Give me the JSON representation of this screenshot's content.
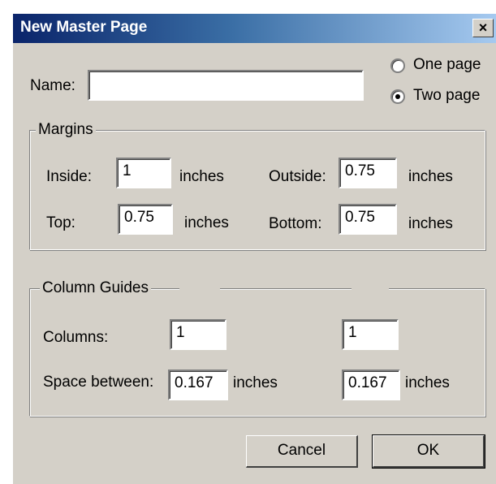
{
  "window": {
    "title": "New Master Page",
    "close_glyph": "×"
  },
  "name_field": {
    "label": "Name:",
    "value": ""
  },
  "page_type": {
    "options": [
      {
        "label": "One page",
        "selected": false
      },
      {
        "label": "Two page",
        "selected": true
      }
    ]
  },
  "margins": {
    "title": "Margins",
    "inside_label": "Inside:",
    "inside_value": "1",
    "outside_label": "Outside:",
    "outside_value": "0.75",
    "top_label": "Top:",
    "top_value": "0.75",
    "bottom_label": "Bottom:",
    "bottom_value": "0.75",
    "unit": "inches"
  },
  "column_guides": {
    "title": "Column Guides",
    "columns_label": "Columns:",
    "columns_left": "1",
    "columns_right": "1",
    "space_label": "Space between:",
    "space_left": "0.167",
    "space_right": "0.167",
    "unit": "inches"
  },
  "buttons": {
    "cancel": "Cancel",
    "ok": "OK"
  }
}
